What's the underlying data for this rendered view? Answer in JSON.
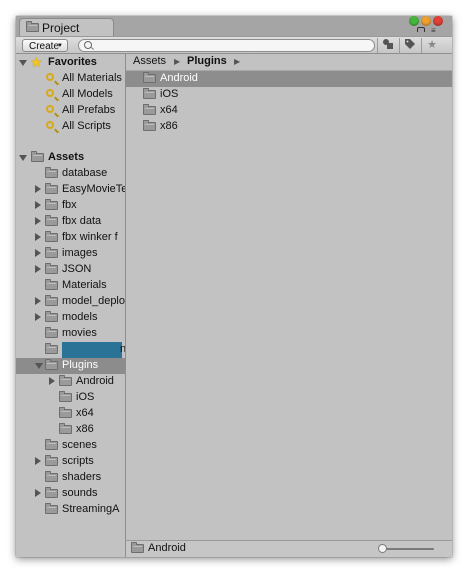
{
  "window": {
    "tab_title": "Project"
  },
  "toolbar": {
    "create_label": "Create",
    "search_value": "",
    "search_placeholder": ""
  },
  "favorites": {
    "header": "Favorites",
    "items": [
      {
        "label": "All Materials"
      },
      {
        "label": "All Models"
      },
      {
        "label": "All Prefabs"
      },
      {
        "label": "All Scripts"
      }
    ]
  },
  "tree": {
    "root": "Assets",
    "items": [
      {
        "label": "database"
      },
      {
        "label": "EasyMovieTe"
      },
      {
        "label": "fbx"
      },
      {
        "label": "fbx data"
      },
      {
        "label": "fbx winker f"
      },
      {
        "label": "images"
      },
      {
        "label": "JSON"
      },
      {
        "label": "Materials"
      },
      {
        "label": "model_deplo"
      },
      {
        "label": "models"
      },
      {
        "label": "movies"
      },
      {
        "label": "n"
      },
      {
        "label": "Plugins"
      },
      {
        "label": "Android"
      },
      {
        "label": "iOS"
      },
      {
        "label": "x64"
      },
      {
        "label": "x86"
      },
      {
        "label": "scenes"
      },
      {
        "label": "scripts"
      },
      {
        "label": "shaders"
      },
      {
        "label": "sounds"
      },
      {
        "label": "StreamingA"
      }
    ]
  },
  "breadcrumb": {
    "root": "Assets",
    "current": "Plugins",
    "separator": "▶"
  },
  "content": {
    "items": [
      {
        "label": "Android"
      },
      {
        "label": "iOS"
      },
      {
        "label": "x64"
      },
      {
        "label": "x86"
      }
    ]
  },
  "status": {
    "selected": "Android"
  },
  "icons": {
    "star": "★",
    "tag": "◆"
  },
  "colors": {
    "selection": "#8c8c8c",
    "redacted_highlight": "#2a7397"
  }
}
